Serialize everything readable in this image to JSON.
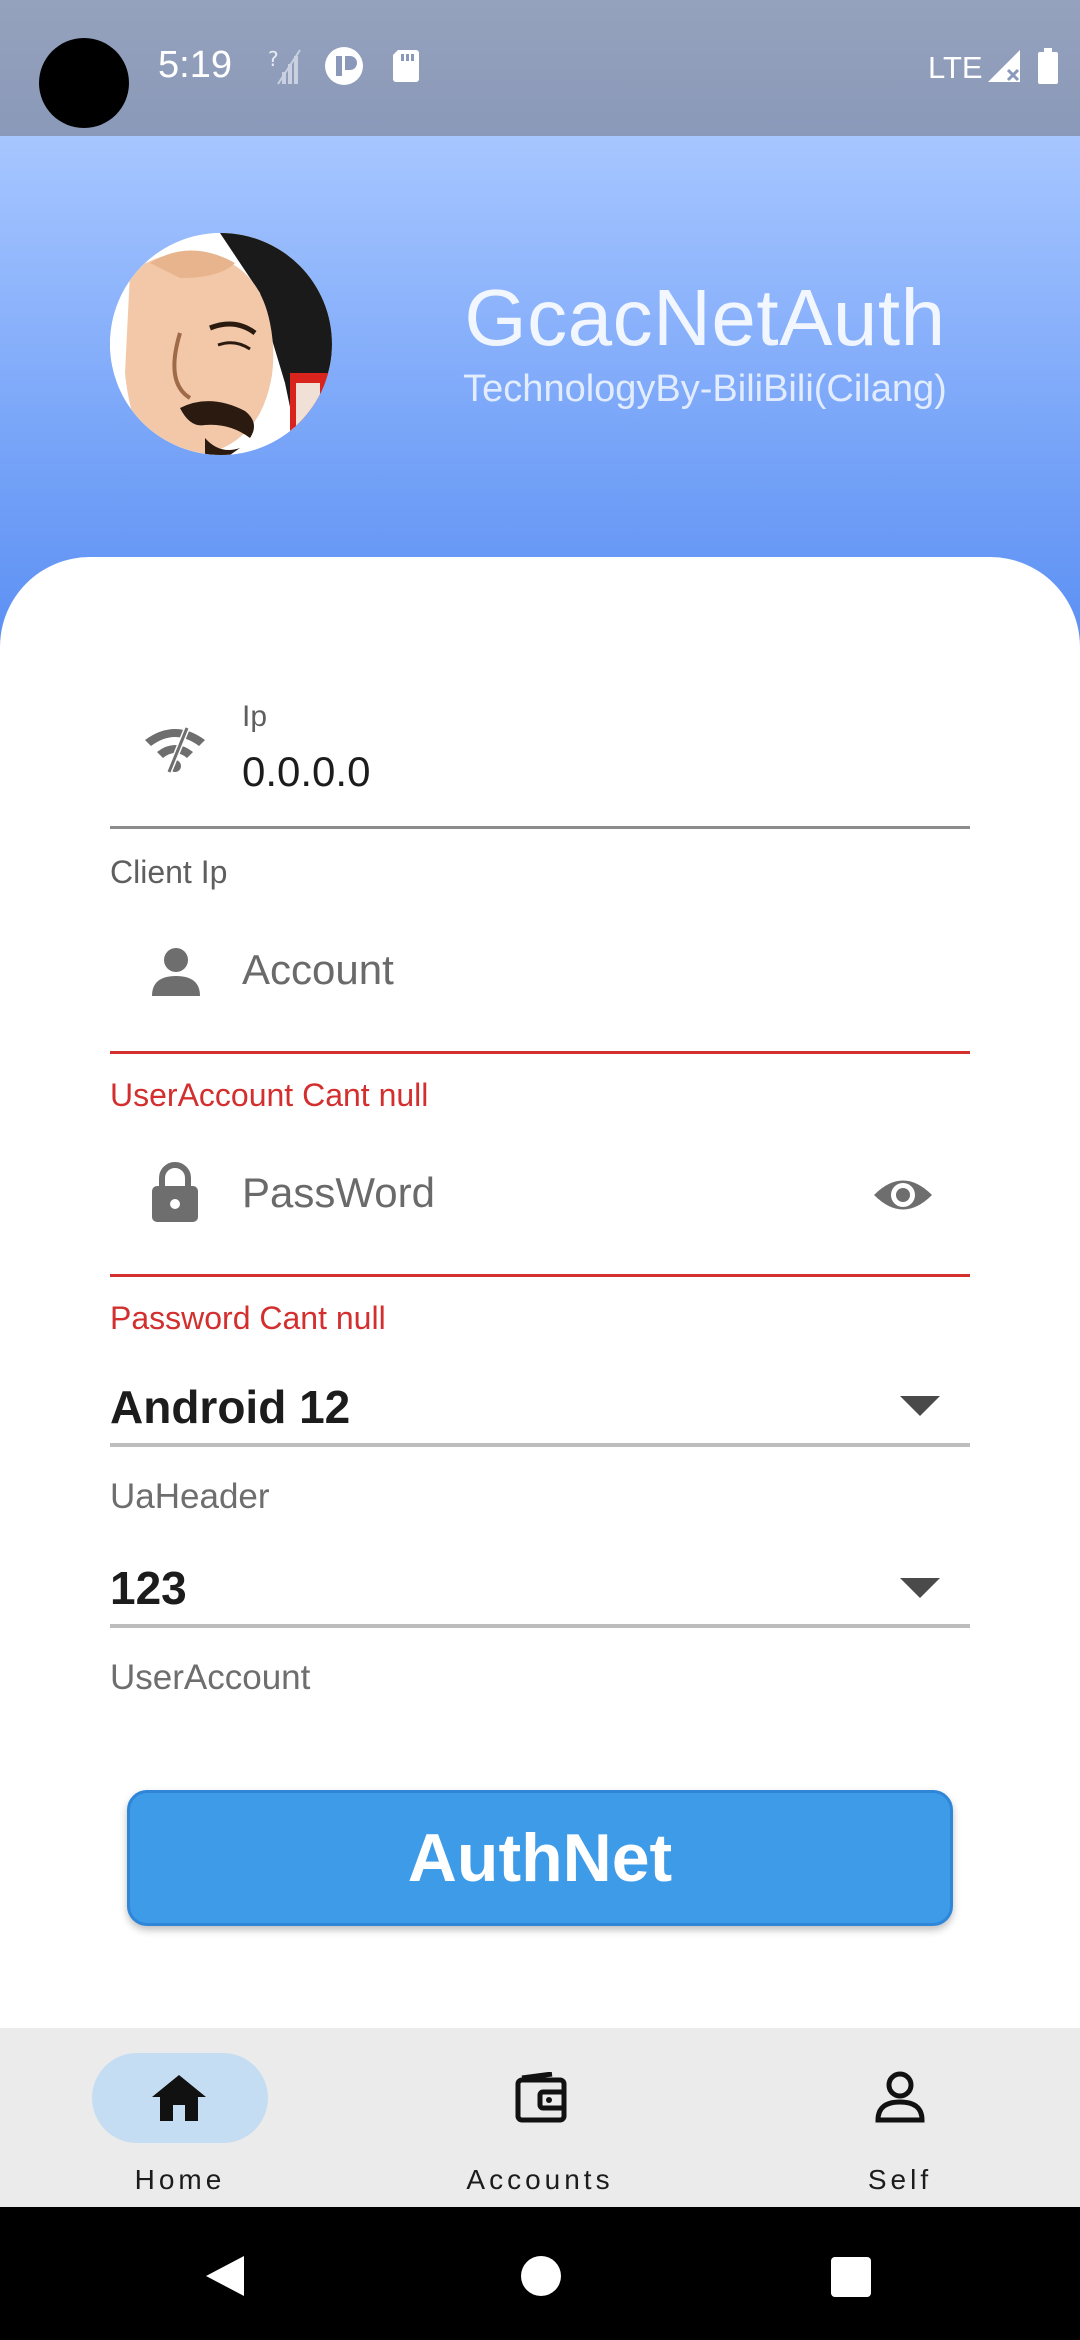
{
  "status_bar": {
    "time": "5:19",
    "network": "LTE",
    "icons": [
      "camera-cutout-icon",
      "signal-unknown-icon",
      "app-notification-icon",
      "sd-card-icon",
      "cell-signal-icon",
      "battery-icon"
    ]
  },
  "header": {
    "title": "GcacNetAuth",
    "subtitle": "TechnologyBy-BiliBili(Cilang)"
  },
  "form": {
    "ip": {
      "label": "Ip",
      "value": "0.0.0.0",
      "helper": "Client Ip",
      "icon": "wifi-off-icon"
    },
    "account": {
      "placeholder": "Account",
      "error": "UserAccount Cant null",
      "icon": "person-icon"
    },
    "password": {
      "placeholder": "PassWord",
      "error": "Password Cant null",
      "icon": "lock-icon",
      "toggle_icon": "eye-icon"
    },
    "ua_header": {
      "value": "Android 12",
      "helper": "UaHeader"
    },
    "user_account": {
      "value": "123",
      "helper": "UserAccount"
    },
    "submit_label": "AuthNet"
  },
  "bottom_nav": {
    "items": [
      {
        "label": "Home",
        "icon": "home-icon",
        "selected": true
      },
      {
        "label": "Accounts",
        "icon": "wallet-icon",
        "selected": false
      },
      {
        "label": "Self",
        "icon": "profile-icon",
        "selected": false
      }
    ]
  },
  "colors": {
    "header_top": "#a6c6ff",
    "header_bottom": "#5a8ff3",
    "button": "#3e9be8",
    "error": "#d32f2f",
    "nav_selected": "#c5ddf2"
  }
}
